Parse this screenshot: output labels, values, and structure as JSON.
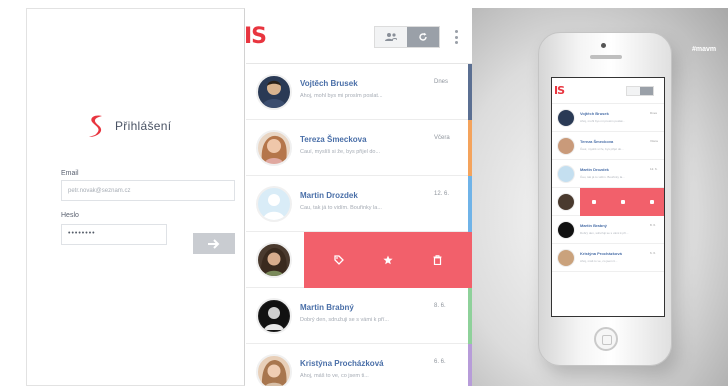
{
  "login": {
    "title": "Přihlášení",
    "email_label": "Email",
    "email_placeholder": "petr.novak@seznam.cz",
    "password_label": "Heslo",
    "password_value": "••••••••"
  },
  "list": {
    "brand": "IS",
    "items": [
      {
        "name": "Vojtěch Brusek",
        "preview": "Ahoj, mohl bys mi prosím poslat...",
        "date": "Dnes",
        "bar": "#5b6f92",
        "avatar": "#2a3a55"
      },
      {
        "name": "Tereza Šmeckova",
        "preview": "Čauí, myslíš si že, bys přijel do...",
        "date": "Včera",
        "bar": "#f4a35c",
        "avatar": "#c99a7a"
      },
      {
        "name": "Martin Drozdek",
        "preview": "Čau, tak já to vidím. Bouřinky la...",
        "date": "12. 6.",
        "bar": "#6fb3e8",
        "avatar": "#c4dff0"
      },
      {
        "name": "",
        "preview": "",
        "date": "",
        "bar": "#f2606b",
        "avatar": "#4a3a2e"
      },
      {
        "name": "Martin Brabný",
        "preview": "Dobrý den, sdružuji se s vámi k pří...",
        "date": "8. 6.",
        "bar": "#8ed19a",
        "avatar": "#222222"
      },
      {
        "name": "Kristýna Procházková",
        "preview": "Ahoj, máš to ve, co jsem ti...",
        "date": "6. 6.",
        "bar": "#b79cd9",
        "avatar": "#caa27c"
      }
    ]
  },
  "showcase": {
    "tag": "#mavm"
  },
  "colors": {
    "accent": "#e8353f",
    "swipe": "#f2606b",
    "name": "#4a6fa8"
  }
}
